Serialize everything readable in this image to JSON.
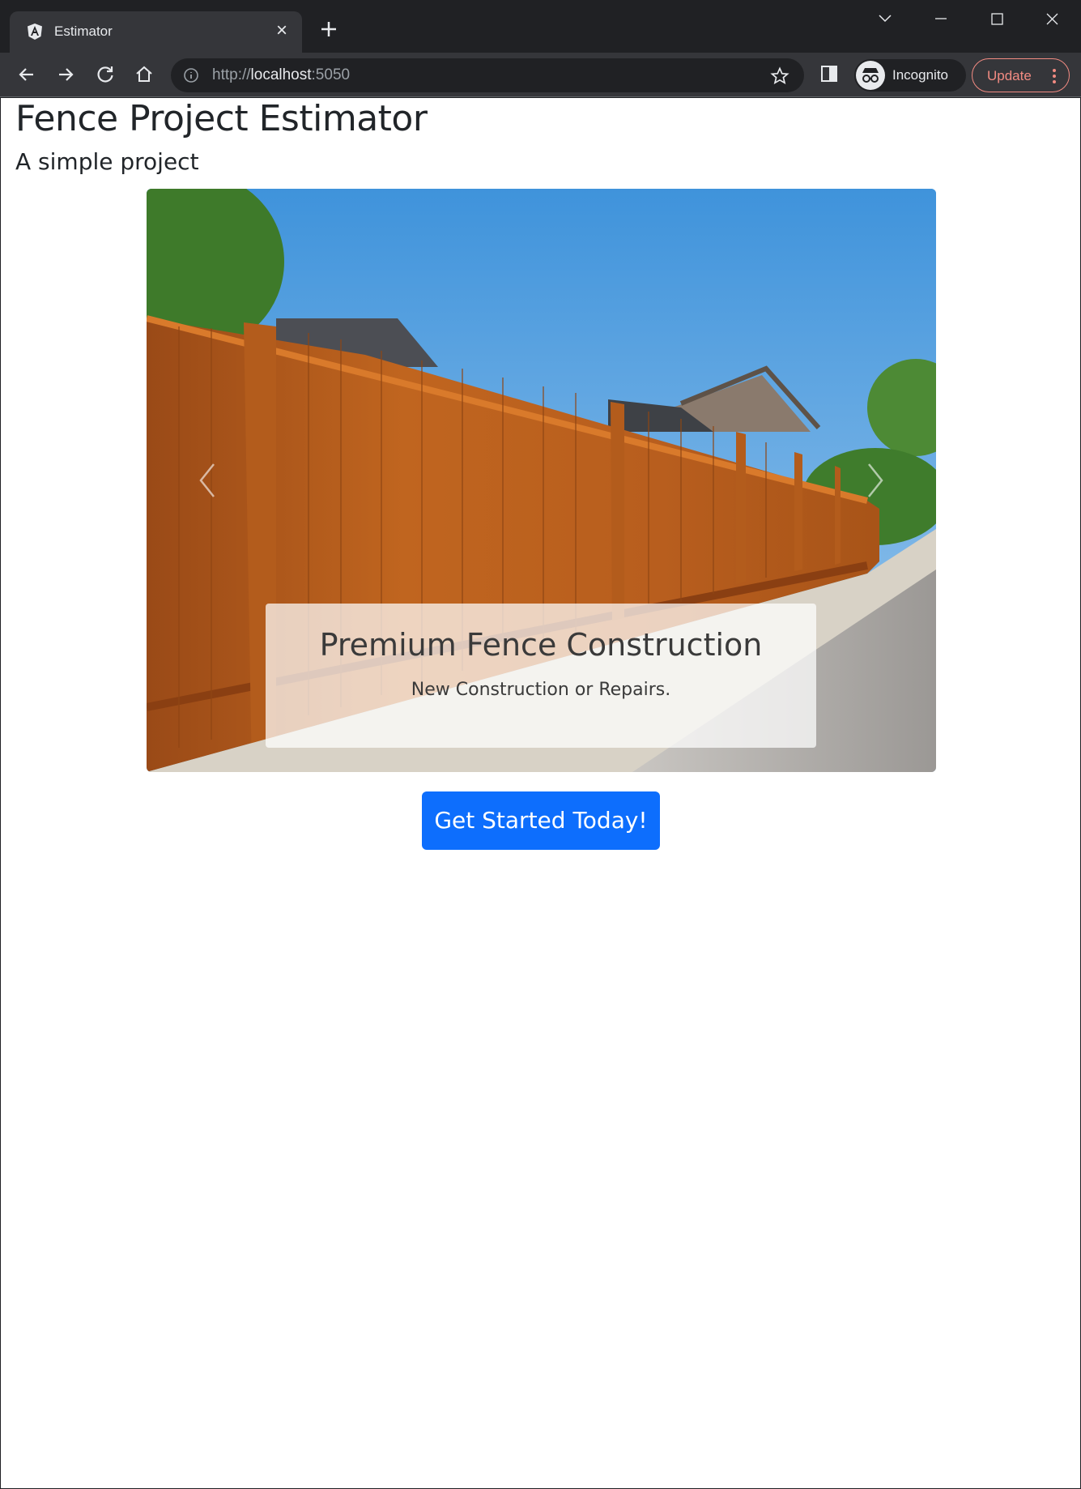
{
  "browser": {
    "tab_title": "Estimator",
    "url_scheme": "http://",
    "url_host": "localhost",
    "url_port": ":5050",
    "profile_label": "Incognito",
    "update_label": "Update",
    "accent_update": "#f28b82"
  },
  "page": {
    "title": "Fence Project Estimator",
    "subtitle": "A simple project"
  },
  "carousel": {
    "slide_title": "Premium Fence Construction",
    "slide_text": "New Construction or Repairs.",
    "image_icon": "fence-photo"
  },
  "cta": {
    "label": "Get Started Today!",
    "color": "#0d6efd"
  }
}
